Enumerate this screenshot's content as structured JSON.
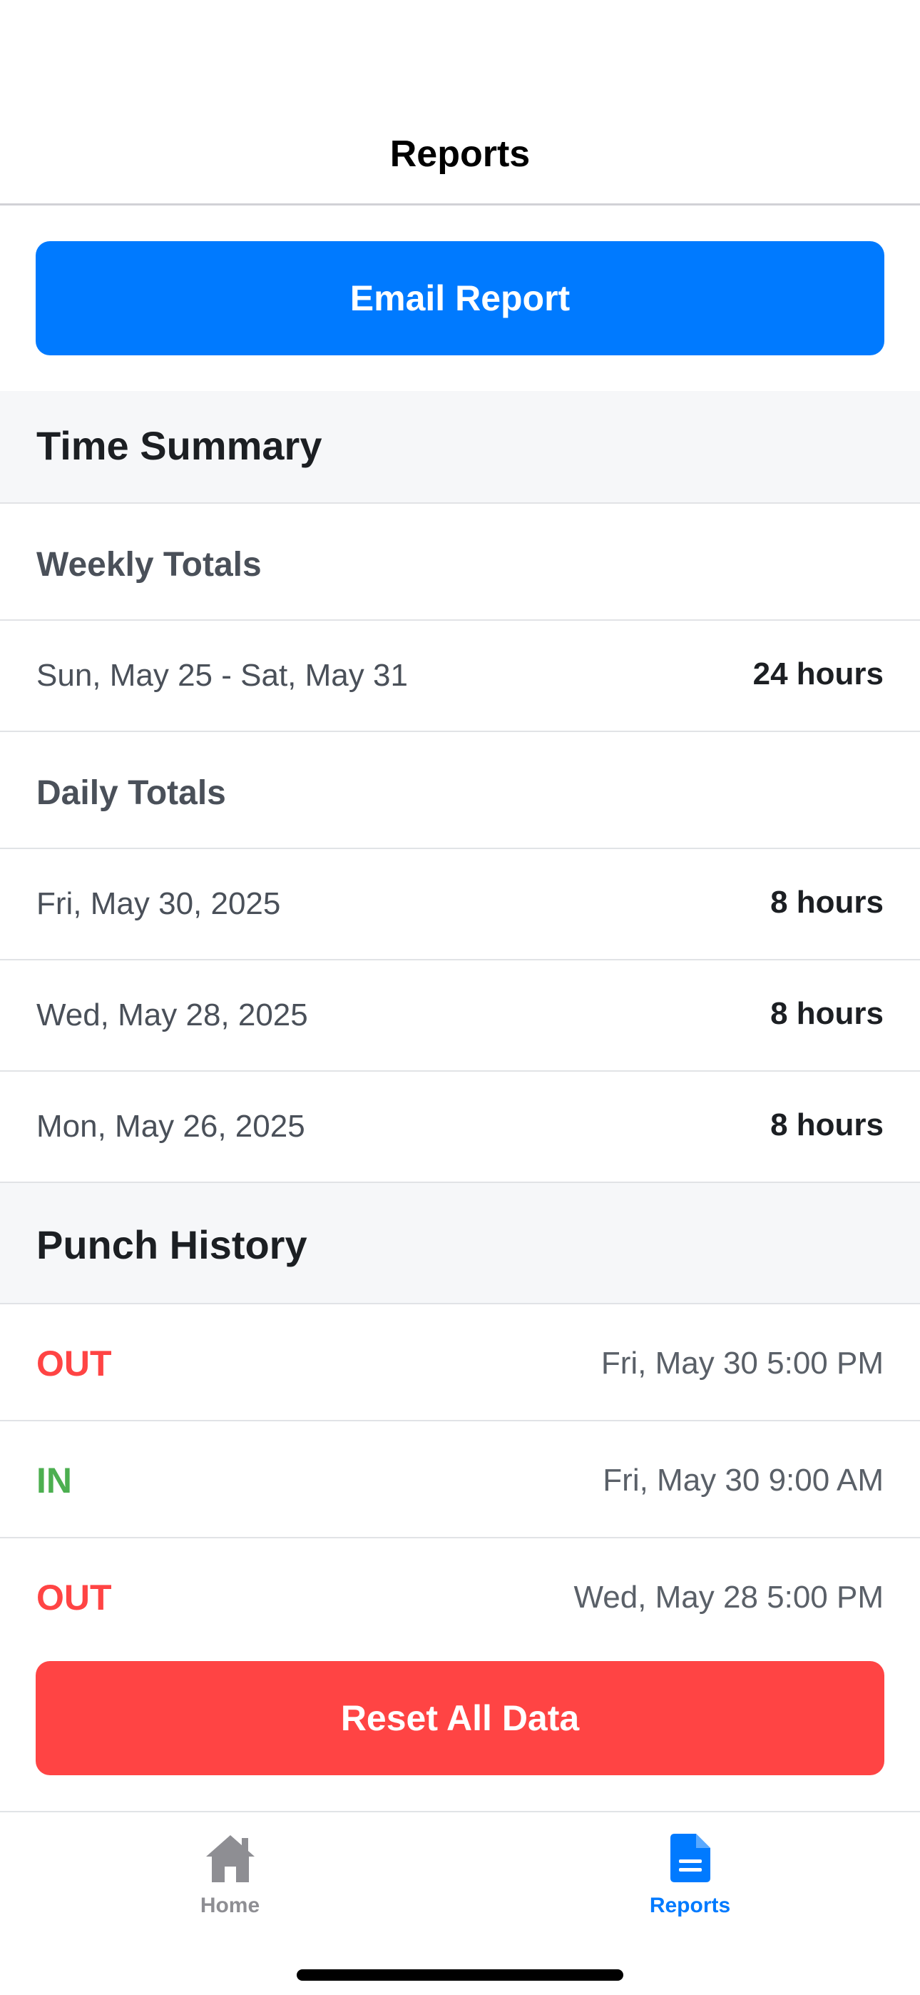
{
  "header": {
    "title": "Reports"
  },
  "actions": {
    "email_label": "Email Report",
    "reset_label": "Reset All Data"
  },
  "summary": {
    "title": "Time Summary",
    "weekly_title": "Weekly Totals",
    "weekly": [
      {
        "range": "Sun, May 25 - Sat, May 31",
        "total": "24 hours"
      }
    ],
    "daily_title": "Daily Totals",
    "daily": [
      {
        "date": "Fri, May 30, 2025",
        "total": "8 hours"
      },
      {
        "date": "Wed, May 28, 2025",
        "total": "8 hours"
      },
      {
        "date": "Mon, May 26, 2025",
        "total": "8 hours"
      }
    ]
  },
  "history": {
    "title": "Punch History",
    "punches": [
      {
        "type": "OUT",
        "time": "Fri, May 30 5:00 PM"
      },
      {
        "type": "IN",
        "time": "Fri, May 30 9:00 AM"
      },
      {
        "type": "OUT",
        "time": "Wed, May 28 5:00 PM"
      }
    ]
  },
  "tabs": [
    {
      "label": "Home",
      "icon": "house-icon",
      "active": false
    },
    {
      "label": "Reports",
      "icon": "document-icon",
      "active": true
    }
  ],
  "colors": {
    "accent": "#007aff",
    "danger": "#ff4444",
    "in": "#4caf50",
    "out": "#ff4444",
    "tab_inactive": "#8e8e93"
  }
}
